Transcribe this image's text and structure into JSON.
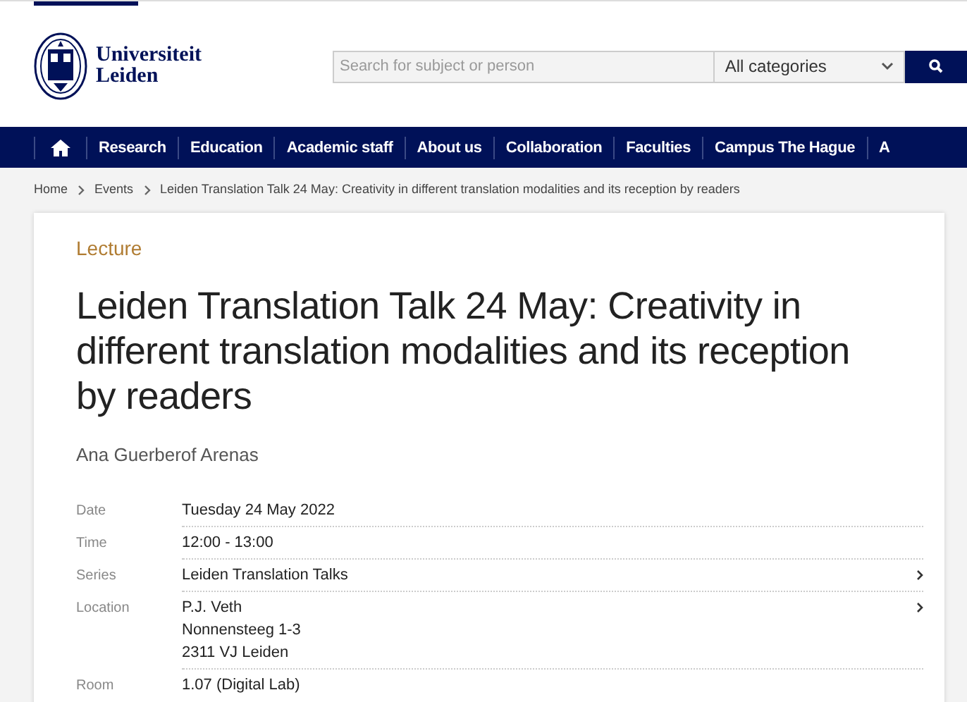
{
  "header": {
    "logo_text": [
      "Universiteit",
      "Leiden"
    ],
    "search": {
      "placeholder": "Search for subject or person"
    },
    "category_select": {
      "value": "All categories"
    }
  },
  "nav": {
    "items": [
      "Research",
      "Education",
      "Academic staff",
      "About us",
      "Collaboration",
      "Faculties",
      "Campus The Hague",
      "A"
    ]
  },
  "breadcrumbs": [
    "Home",
    "Events",
    "Leiden Translation Talk 24 May: Creativity in different translation modalities and its reception by readers"
  ],
  "event": {
    "type": "Lecture",
    "title": "Leiden Translation Talk 24 May: Creativity in different translation modalities and its reception by readers",
    "speaker": "Ana Guerberof Arenas",
    "details": [
      {
        "label": "Date",
        "lines": [
          "Tuesday 24 May 2022"
        ],
        "link": false
      },
      {
        "label": "Time",
        "lines": [
          "12:00 - 13:00"
        ],
        "link": false
      },
      {
        "label": "Series",
        "lines": [
          "Leiden Translation Talks"
        ],
        "link": true
      },
      {
        "label": "Location",
        "lines": [
          "P.J. Veth",
          "Nonnensteeg 1-3",
          "2311 VJ Leiden"
        ],
        "link": true
      },
      {
        "label": "Room",
        "lines": [
          "1.07 (Digital Lab)"
        ],
        "link": false
      }
    ]
  }
}
